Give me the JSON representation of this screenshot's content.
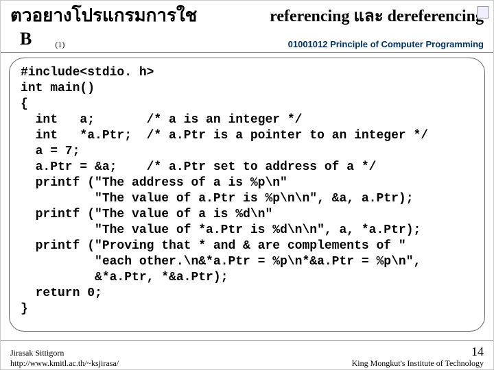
{
  "header": {
    "title_left_line1": "ตวอยางโปรแกรมการใช",
    "title_right": "referencing และ dereferencing",
    "title_b": "B",
    "sub_one": "(1)",
    "course": "01001012 Principle of Computer Programming"
  },
  "code": "#include<stdio. h>\nint main()\n{\n  int   a;       /* a is an integer */\n  int   *a.Ptr;  /* a.Ptr is a pointer to an integer */\n  a = 7;\n  a.Ptr = &a;    /* a.Ptr set to address of a */\n  printf (\"The address of a is %p\\n\"\n          \"The value of a.Ptr is %p\\n\\n\", &a, a.Ptr);\n  printf (\"The value of a is %d\\n\"\n          \"The value of *a.Ptr is %d\\n\\n\", a, *a.Ptr);\n  printf (\"Proving that * and & are complements of \"\n          \"each other.\\n&*a.Ptr = %p\\n*&a.Ptr = %p\\n\",\n          &*a.Ptr, *&a.Ptr);\n  return 0;\n}",
  "footer": {
    "author": "Jirasak Sittigorn",
    "url": "http://www.kmitl.ac.th/~ksjirasa/",
    "page": "14",
    "institute": "King Mongkut's Institute of Technology"
  }
}
